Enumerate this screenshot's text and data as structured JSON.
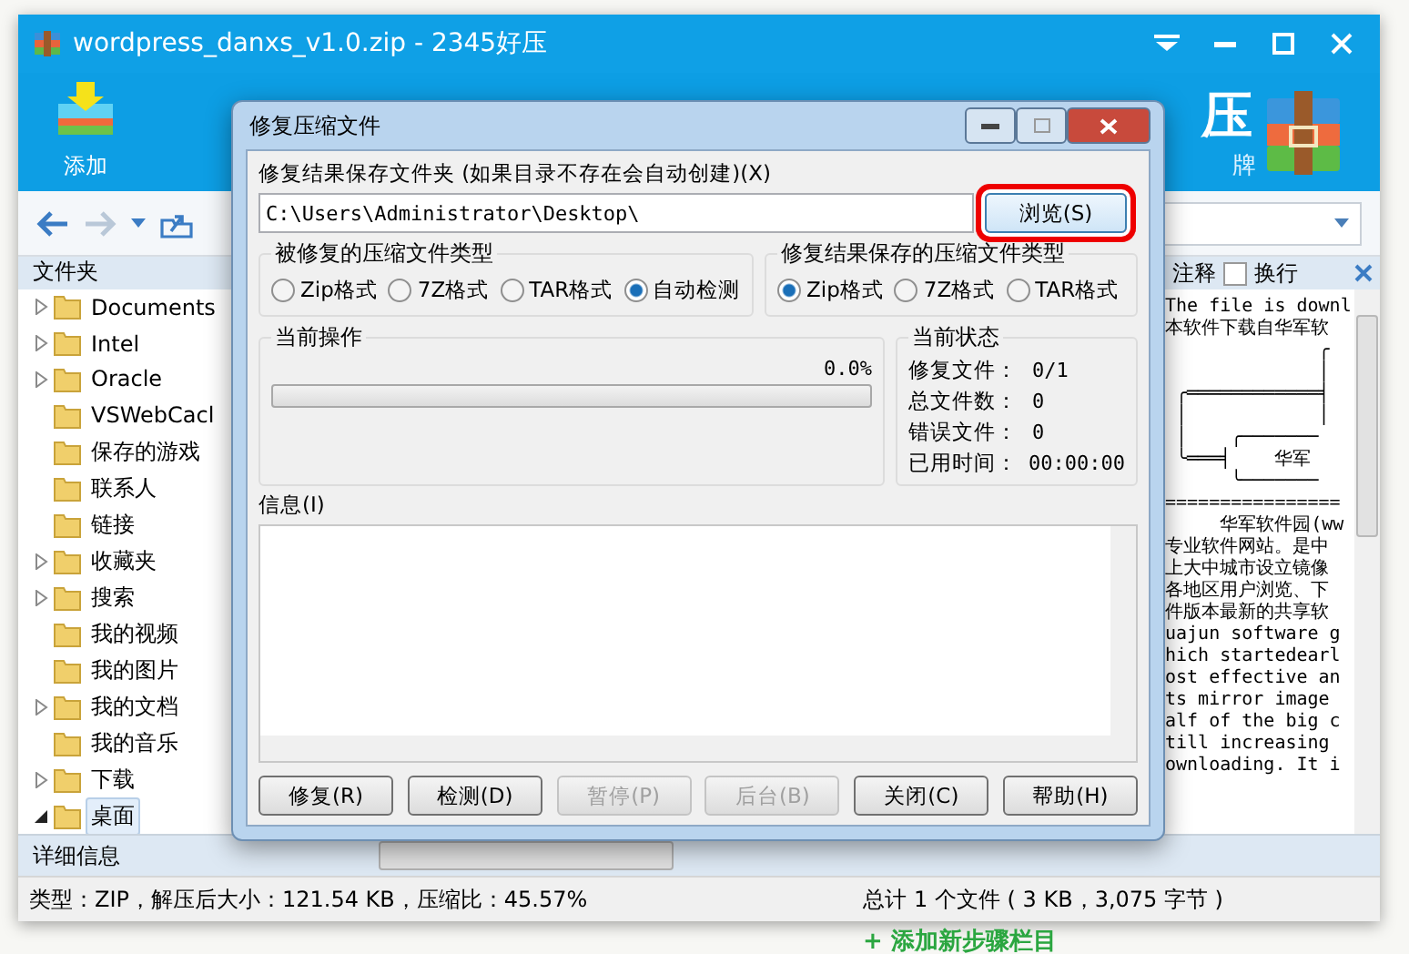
{
  "window": {
    "title": "wordpress_danxs_v1.0.zip - 2345好压"
  },
  "toolbar": {
    "buttons": [
      {
        "label": "添加"
      }
    ],
    "logo": {
      "mark": "压",
      "tagline": "牌"
    }
  },
  "folder_panel": {
    "title": "文件夹",
    "items": [
      {
        "label": "Documents",
        "expanded": false,
        "selected": false
      },
      {
        "label": "Intel",
        "expanded": false,
        "selected": false
      },
      {
        "label": "Oracle",
        "expanded": false,
        "selected": false
      },
      {
        "label": "VSWebCacl",
        "selected": false
      },
      {
        "label": "保存的游戏",
        "selected": false
      },
      {
        "label": "联系人",
        "selected": false
      },
      {
        "label": "链接",
        "selected": false
      },
      {
        "label": "收藏夹",
        "expanded": false,
        "selected": false
      },
      {
        "label": "搜索",
        "expanded": false,
        "selected": false
      },
      {
        "label": "我的视频",
        "selected": false
      },
      {
        "label": "我的图片",
        "selected": false
      },
      {
        "label": "我的文档",
        "expanded": false,
        "selected": false
      },
      {
        "label": "我的音乐",
        "selected": false
      },
      {
        "label": "下载",
        "expanded": false,
        "selected": false
      },
      {
        "label": "桌面",
        "expanded": true,
        "selected": true
      }
    ]
  },
  "comment_panel": {
    "title": "注释",
    "wrap_label": "换行",
    "wrap_checked": false,
    "lines": [
      "The file is downl",
      "本软件下载自华军软",
      "              ╭",
      "              │",
      " ╭════════════╡",
      " │            │",
      " │    ╭───────",
      " ╰═══╡    华军",
      "      ╰───────",
      "================",
      "     华军软件园(ww",
      "专业软件网站。是中",
      "上大中城市设立镜像",
      "各地区用户浏览、下",
      "件版本最新的共享软",
      "uajun software g",
      "hich startedearl",
      "ost effective an",
      "ts mirror image",
      "alf of the big c",
      "till increasing",
      "ownloading. It i"
    ]
  },
  "details_bar": {
    "label": "详细信息"
  },
  "status_bar": {
    "left": "类型：ZIP，解压后大小：121.54 KB，压缩比：45.57%",
    "right": "总计 1 个文件 ( 3 KB，3,075 字节 )"
  },
  "dialog": {
    "title": "修复压缩文件",
    "folder_label": "修复结果保存文件夹 (如果目录不存在会自动创建)(X)",
    "folder_value": "C:\\Users\\Administrator\\Desktop\\",
    "browse_button": {
      "label": "浏览(S)",
      "highlighted": true
    },
    "source_type": {
      "title": "被修复的压缩文件类型",
      "options": [
        {
          "label": "Zip格式",
          "selected": false
        },
        {
          "label": "7Z格式",
          "selected": false
        },
        {
          "label": "TAR格式",
          "selected": false
        },
        {
          "label": "自动检测",
          "selected": true
        }
      ]
    },
    "target_type": {
      "title": "修复结果保存的压缩文件类型",
      "options": [
        {
          "label": "Zip格式",
          "selected": true
        },
        {
          "label": "7Z格式",
          "selected": false
        },
        {
          "label": "TAR格式",
          "selected": false
        }
      ]
    },
    "operation": {
      "title": "当前操作",
      "percent": "0.0%",
      "level": 0
    },
    "status": {
      "title": "当前状态",
      "rows": [
        {
          "label": "修复文件：",
          "value": "0/1"
        },
        {
          "label": "总文件数：",
          "value": "0"
        },
        {
          "label": "错误文件：",
          "value": "0"
        },
        {
          "label": "已用时间：",
          "value": "00:00:00"
        }
      ]
    },
    "info_label": "信息(I)",
    "buttons": [
      {
        "label": "修复(R)",
        "disabled": false
      },
      {
        "label": "检测(D)",
        "disabled": false
      },
      {
        "label": "暂停(P)",
        "disabled": true
      },
      {
        "label": "后台(B)",
        "disabled": true
      },
      {
        "label": "关闭(C)",
        "disabled": false
      },
      {
        "label": "帮助(H)",
        "disabled": false
      }
    ]
  },
  "page_link": {
    "label": "+ 添加新步骤栏目"
  }
}
